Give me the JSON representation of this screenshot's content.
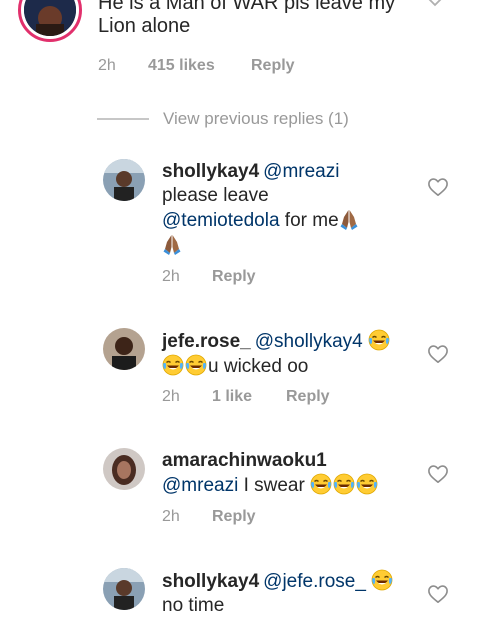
{
  "top_comment": {
    "text_line1": "He is a Man of WAR pls leave my",
    "text_line2": "Lion alone",
    "time": "2h",
    "likes": "415 likes",
    "reply": "Reply"
  },
  "view_previous": "View previous replies (1)",
  "replies": [
    {
      "username": "shollykay4",
      "mention": "@mreazi",
      "line2": "please leave",
      "mention2": "@temiotedola",
      "line3_tail": " for me",
      "time": "2h",
      "reply": "Reply"
    },
    {
      "username": "jefe.rose_",
      "mention": "@shollykay4",
      "text": "u wicked oo",
      "time": "2h",
      "likes": "1 like",
      "reply": "Reply"
    },
    {
      "username": "amarachinwaoku1",
      "mention": "@mreazi",
      "text": " I swear ",
      "time": "2h",
      "reply": "Reply"
    },
    {
      "username": "shollykay4",
      "mention": "@jefe.rose_",
      "text": "no time"
    }
  ],
  "icons": {
    "heart": "heart-outline-icon",
    "laugh": "face-with-tears-of-joy-icon",
    "pray": "folded-hands-icon",
    "chevron": "chevron-down-icon"
  },
  "colors": {
    "text": "#262626",
    "mention": "#003569",
    "meta": "#999999",
    "story_ring": "#e1306c"
  }
}
